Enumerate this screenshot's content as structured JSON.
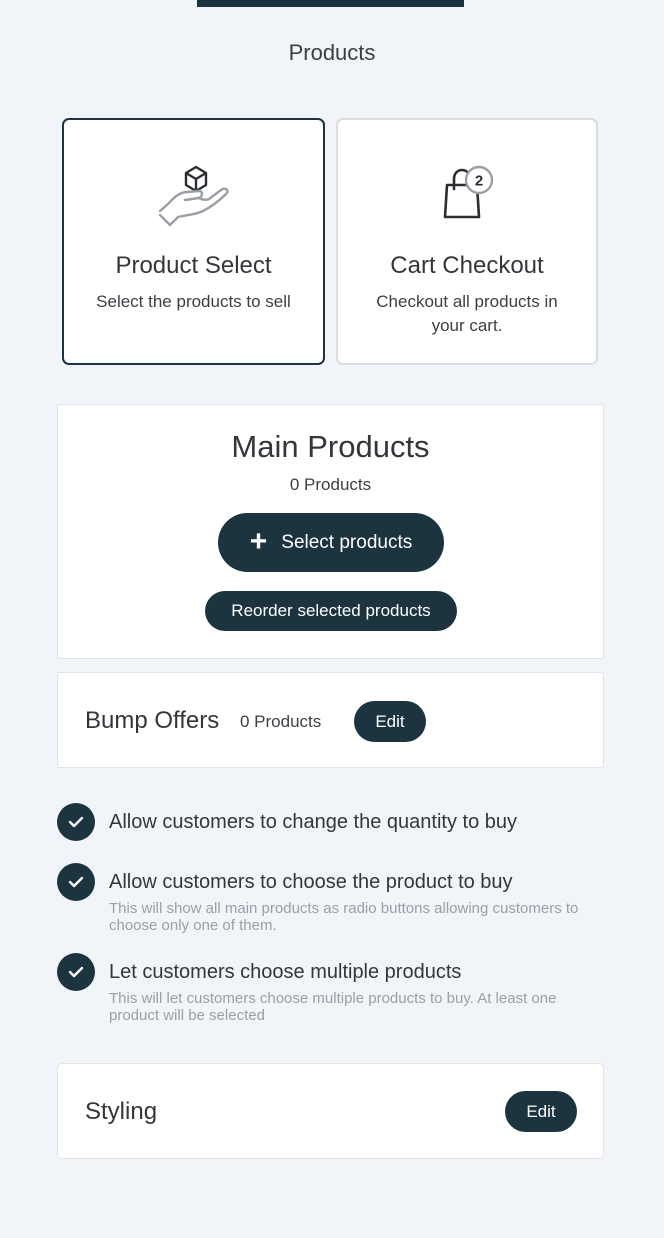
{
  "page": {
    "title": "Products"
  },
  "modes": [
    {
      "title": "Product Select",
      "description": "Select the products to sell",
      "icon": "hand-box-icon",
      "selected": true
    },
    {
      "title": "Cart Checkout",
      "description": "Checkout all products in your cart.",
      "icon": "shopping-bag-icon",
      "badge": "2",
      "selected": false
    }
  ],
  "main_products": {
    "title": "Main Products",
    "count_text": "0 Products",
    "select_button": "Select products",
    "reorder_button": "Reorder selected products"
  },
  "bump_offers": {
    "title": "Bump Offers",
    "count_text": "0 Products",
    "edit_button": "Edit"
  },
  "options": [
    {
      "label": "Allow customers to change the quantity to buy",
      "help": "",
      "checked": true
    },
    {
      "label": "Allow customers to choose the product to buy",
      "help": "This will show all main products as radio buttons allowing customers to choose only one of them.",
      "checked": true
    },
    {
      "label": "Let customers choose multiple products",
      "help": "This will let customers choose multiple products to buy. At least one product will be selected",
      "checked": true
    }
  ],
  "styling": {
    "title": "Styling",
    "edit_button": "Edit"
  },
  "colors": {
    "accent": "#1c3340",
    "background": "#f1f4f8",
    "card": "#ffffff",
    "muted_text": "#9aa0a6"
  }
}
